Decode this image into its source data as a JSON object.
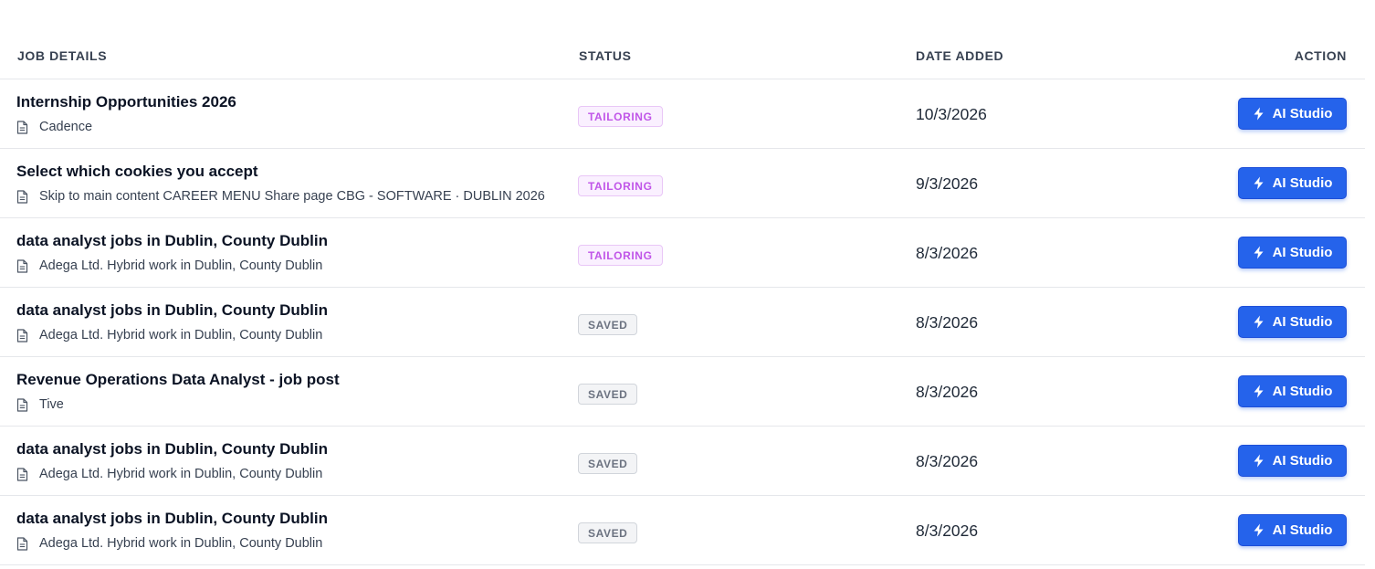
{
  "table": {
    "headers": {
      "job_details": "JOB DETAILS",
      "status": "STATUS",
      "date_added": "DATE ADDED",
      "action": "ACTION"
    },
    "action_label": "AI Studio",
    "icons": {
      "company": "document-icon",
      "action": "lightning-bolt-icon"
    },
    "colors": {
      "primary_button": "#2563eb",
      "tailoring_badge_text": "#c055e8",
      "tailoring_badge_bg": "#faf0ff",
      "saved_badge_text": "#6b7280",
      "saved_badge_bg": "#f3f4f6"
    },
    "rows": [
      {
        "title": "Internship Opportunities 2026",
        "company": "Cadence",
        "status": "TAILORING",
        "date": "10/3/2026"
      },
      {
        "title": "Select which cookies you accept",
        "company": "Skip to main content CAREER MENU Share page CBG - SOFTWARE · DUBLIN 2026",
        "status": "TAILORING",
        "date": "9/3/2026"
      },
      {
        "title": "data analyst jobs in Dublin, County Dublin",
        "company": "Adega Ltd. Hybrid work in Dublin, County Dublin",
        "status": "TAILORING",
        "date": "8/3/2026"
      },
      {
        "title": "data analyst jobs in Dublin, County Dublin",
        "company": "Adega Ltd. Hybrid work in Dublin, County Dublin",
        "status": "SAVED",
        "date": "8/3/2026"
      },
      {
        "title": "Revenue Operations Data Analyst - job post",
        "company": "Tive",
        "status": "SAVED",
        "date": "8/3/2026"
      },
      {
        "title": "data analyst jobs in Dublin, County Dublin",
        "company": "Adega Ltd. Hybrid work in Dublin, County Dublin",
        "status": "SAVED",
        "date": "8/3/2026"
      },
      {
        "title": "data analyst jobs in Dublin, County Dublin",
        "company": "Adega Ltd. Hybrid work in Dublin, County Dublin",
        "status": "SAVED",
        "date": "8/3/2026"
      }
    ]
  }
}
